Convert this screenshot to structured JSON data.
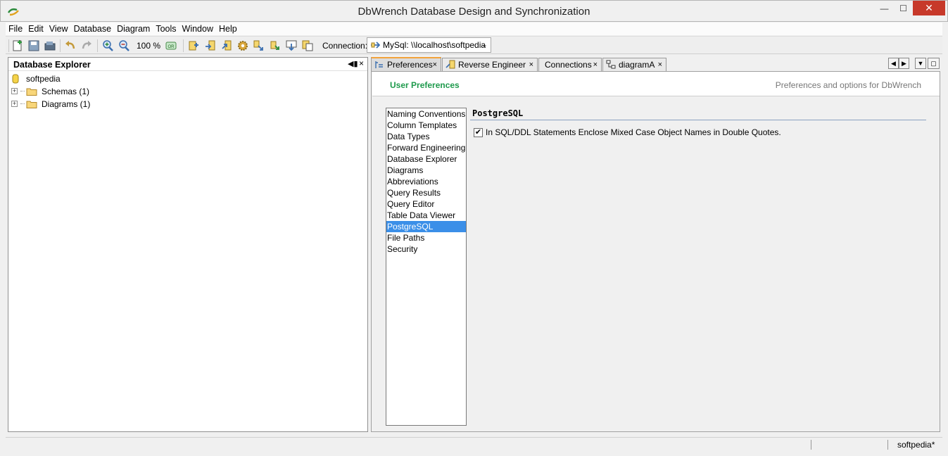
{
  "window": {
    "title": "DbWrench Database Design and Synchronization",
    "minimize_glyph": "—",
    "maximize_glyph": "☐",
    "close_glyph": "✕"
  },
  "menu": [
    "File",
    "Edit",
    "View",
    "Database",
    "Diagram",
    "Tools",
    "Window",
    "Help"
  ],
  "toolbar": {
    "zoom": "100 %",
    "connection_label": "Connection:",
    "connection_value": "MySql: \\\\localhost\\softpedia",
    "icons": [
      "new-icon",
      "save-icon",
      "open-icon",
      "undo-icon",
      "redo-icon",
      "zoom-in-icon",
      "zoom-out-icon",
      "zoom-reset-icon",
      "sync-icon",
      "import-icon",
      "export-icon",
      "settings-gear-icon",
      "transfer-icon",
      "compare-icon",
      "download-icon",
      "copy-icon"
    ]
  },
  "explorer": {
    "title": "Database Explorer",
    "pin_glyph": "◀▮",
    "close_glyph": "×",
    "root": "softpedia",
    "nodes": [
      "Schemas (1)",
      "Diagrams (1)"
    ],
    "expander_glyph": "+"
  },
  "tabs": [
    {
      "label": "Preferences",
      "active": true
    },
    {
      "label": "Reverse Engineer",
      "active": false
    },
    {
      "label": "Connections",
      "active": false
    },
    {
      "label": "diagramA",
      "active": false
    }
  ],
  "tab_close_glyph": "×",
  "preferences": {
    "header_title": "User Preferences",
    "header_subtitle": "Preferences and options for DbWrench",
    "categories": [
      "Naming Conventions",
      "Column Templates",
      "Data Types",
      "Forward Engineering",
      "Database Explorer",
      "Diagrams",
      "Abbreviations",
      "Query Results",
      "Query Editor",
      "Table Data Viewer",
      "PostgreSQL",
      "File Paths",
      "Security"
    ],
    "selected": "PostgreSQL",
    "section_title": "PostgreSQL",
    "option_label": "In SQL/DDL Statements Enclose Mixed Case Object Names in Double Quotes.",
    "option_checked": true,
    "check_glyph": "✔"
  },
  "status": {
    "text": "softpedia*"
  },
  "colors": {
    "accent_green": "#1e9a4c",
    "selection_blue": "#3b8fe8",
    "active_tab_orange": "#f2a33c",
    "close_red": "#c7392a"
  }
}
